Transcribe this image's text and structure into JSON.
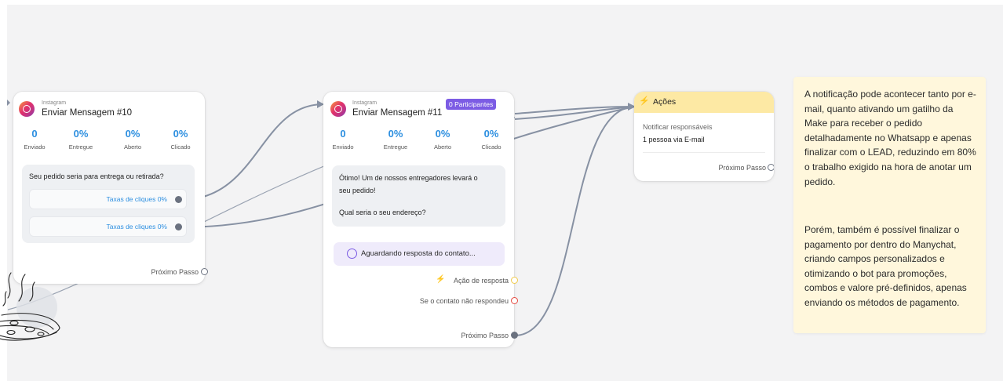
{
  "card1": {
    "source": "Instagram",
    "title": "Enviar Mensagem #10",
    "stats": [
      {
        "value": "0",
        "label": "Enviado"
      },
      {
        "value": "0%",
        "label": "Entregue"
      },
      {
        "value": "0%",
        "label": "Aberto"
      },
      {
        "value": "0%",
        "label": "Clicado"
      }
    ],
    "message": "Seu pedido seria para entrega ou retirada?",
    "buttons": [
      "Taxas de cliques 0%",
      "Taxas de cliques 0%"
    ],
    "next_step": "Próximo Passo"
  },
  "card2": {
    "source": "Instagram",
    "title": "Enviar Mensagem #11",
    "badge": "0 Participantes",
    "stats": [
      {
        "value": "0",
        "label": "Enviado"
      },
      {
        "value": "0%",
        "label": "Entregue"
      },
      {
        "value": "0%",
        "label": "Aberto"
      },
      {
        "value": "0%",
        "label": "Clicado"
      }
    ],
    "message_line1": "Ótimo! Um de nossos entregadores levará o",
    "message_line2": "seu pedido!",
    "message_line3": "Qual seria o seu endereço?",
    "waiting": "Aguardando resposta do contato...",
    "response_action": "Ação de resposta",
    "no_response": "Se o contato não respondeu",
    "next_step": "Próximo Passo"
  },
  "card3": {
    "title": "Ações",
    "action_name": "Notificar responsáveis",
    "action_detail": "1 pessoa via E-mail",
    "next_step": "Próximo Passo"
  },
  "note": {
    "paragraph1": "A notificação pode acontecer tanto por e-mail, quanto ativando um gatilho da Make para receber o pedido detalhadamente no Whatsapp e apenas finalizar com o LEAD, reduzindo em 80% o trabalho exigido na hora de anotar um pedido.",
    "paragraph2": "Porém, também é possível finalizar o pagamento por dentro do Manychat, criando campos personalizados e otimizando o bot para promoções, combos e valore pré-definidos, apenas enviando os métodos de pagamento."
  },
  "colors": {
    "accent_blue": "#2d8fe0",
    "badge_purple": "#7c5ce4",
    "actions_header": "#fde9a4",
    "note_bg": "#fff7dc",
    "wire": "#8791a3"
  },
  "icons": [
    "instagram-icon",
    "lightning-icon",
    "chat-bubble-icon",
    "pizza-sketch-icon"
  ]
}
